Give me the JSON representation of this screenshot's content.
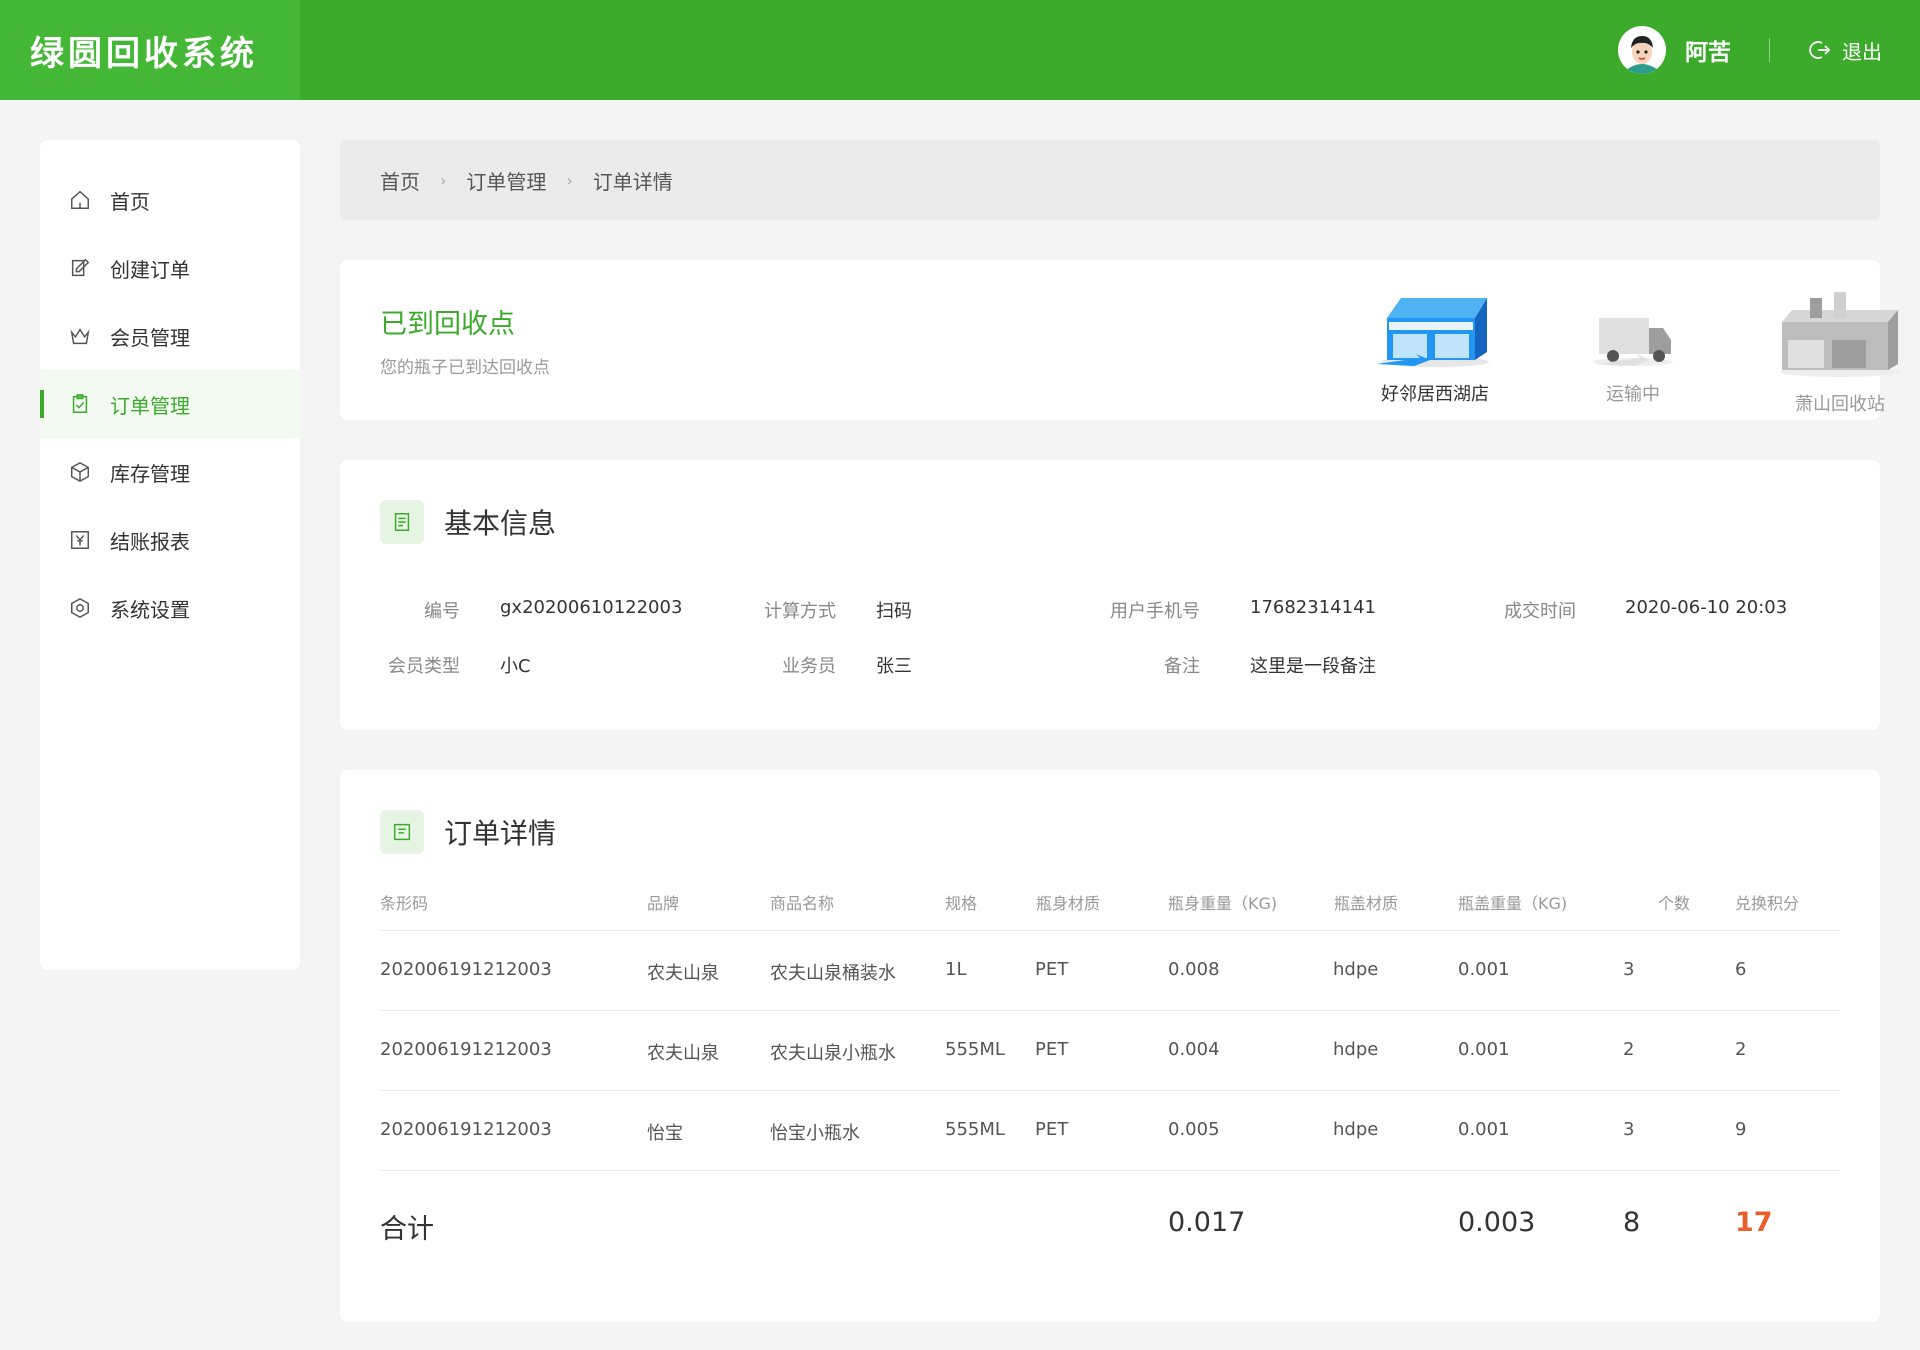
{
  "app": {
    "title": "绿圆回收系统"
  },
  "user": {
    "name": "阿苦",
    "logout_label": "退出"
  },
  "sidebar": {
    "items": [
      {
        "label": "首页",
        "icon": "home-icon"
      },
      {
        "label": "创建订单",
        "icon": "edit-icon"
      },
      {
        "label": "会员管理",
        "icon": "crown-icon"
      },
      {
        "label": "订单管理",
        "icon": "clipboard-icon",
        "active": true
      },
      {
        "label": "库存管理",
        "icon": "box-icon"
      },
      {
        "label": "结账报表",
        "icon": "yen-icon"
      },
      {
        "label": "系统设置",
        "icon": "settings-icon"
      }
    ]
  },
  "breadcrumb": [
    "首页",
    "订单管理",
    "订单详情"
  ],
  "status": {
    "title": "已到回收点",
    "subtitle": "您的瓶子已到达回收点",
    "steps": [
      {
        "label": "好邻居西湖店",
        "active": true
      },
      {
        "label": "运输中",
        "active": false
      },
      {
        "label": "萧山回收站",
        "active": false
      }
    ]
  },
  "basic_info": {
    "title": "基本信息",
    "fields": [
      {
        "label": "编号",
        "value": "gx20200610122003"
      },
      {
        "label": "计算方式",
        "value": "扫码"
      },
      {
        "label": "用户手机号",
        "value": "17682314141"
      },
      {
        "label": "成交时间",
        "value": "2020-06-10 20:03"
      },
      {
        "label": "会员类型",
        "value": "小C"
      },
      {
        "label": "业务员",
        "value": "张三"
      },
      {
        "label": "备注",
        "value": "这里是一段备注"
      }
    ]
  },
  "order_detail": {
    "title": "订单详情",
    "columns": [
      "条形码",
      "品牌",
      "商品名称",
      "规格",
      "瓶身材质",
      "瓶身重量（KG)",
      "瓶盖材质",
      "瓶盖重量（KG)",
      "个数",
      "兑换积分"
    ],
    "rows": [
      [
        "202006191212003",
        "农夫山泉",
        "农夫山泉桶装水",
        "1L",
        "PET",
        "0.008",
        "hdpe",
        "0.001",
        "3",
        "6"
      ],
      [
        "202006191212003",
        "农夫山泉",
        "农夫山泉小瓶水",
        "555ML",
        "PET",
        "0.004",
        "hdpe",
        "0.001",
        "2",
        "2"
      ],
      [
        "202006191212003",
        "怡宝",
        "怡宝小瓶水",
        "555ML",
        "PET",
        "0.005",
        "hdpe",
        "0.001",
        "3",
        "9"
      ]
    ],
    "total": {
      "label": "合计",
      "body_weight": "0.017",
      "cap_weight": "0.003",
      "count": "8",
      "points": "17"
    }
  },
  "colors": {
    "brand": "#3cab2b",
    "logo_bg": "#44b836",
    "accent_red": "#e85f2c",
    "step_blue": "#2196f3"
  }
}
